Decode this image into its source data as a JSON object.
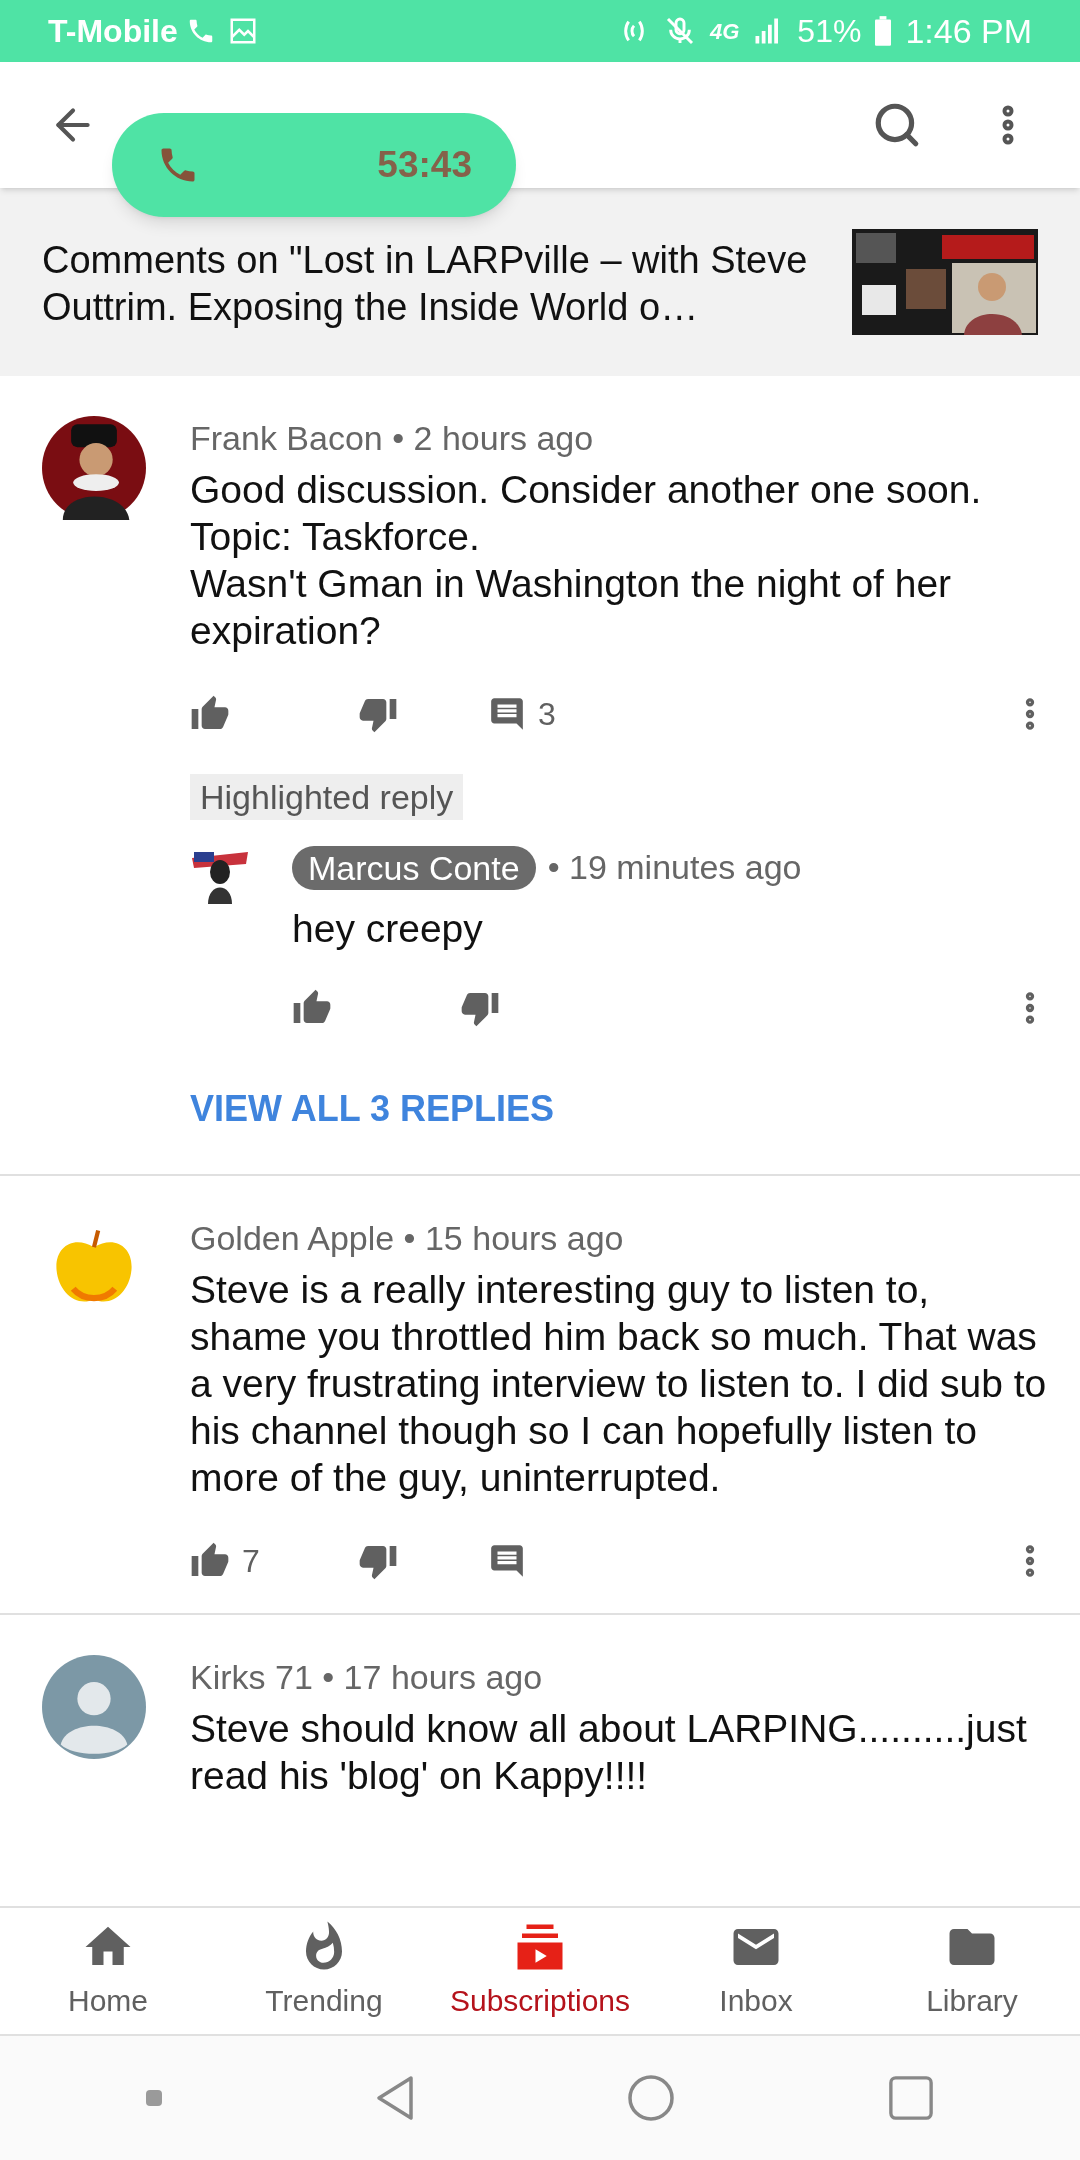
{
  "status_bar": {
    "carrier": "T-Mobile",
    "network": "4G",
    "battery": "51%",
    "time": "1:46 PM"
  },
  "call_pill": {
    "duration": "53:43"
  },
  "video_header": {
    "title": "Comments on \"Lost in LARPville – with Steve Outtrim. Exposing the Inside World o…"
  },
  "comments": [
    {
      "author": "Frank Bacon",
      "time": "• 2 hours ago",
      "avatar": {
        "kind": "portrait"
      },
      "text": "Good discussion. Consider another one soon.\nTopic: Taskforce.\nWasn't Gman in Washington the night of her expiration?",
      "reply_count": "3",
      "highlighted_label": "Highlighted reply",
      "reply": {
        "author": "Marcus Conte",
        "author_chip": true,
        "time": "• 19 minutes ago",
        "text": "hey creepy"
      },
      "view_replies": "VIEW ALL 3 REPLIES"
    },
    {
      "author": "Golden Apple",
      "time": "• 15 hours ago",
      "avatar": {
        "kind": "apple"
      },
      "text": "Steve is a really interesting guy to listen to, shame you throttled him back so much. That was a very frustrating interview to listen to. I did sub to his channel though so I can hopefully listen to more of the guy, uninterrupted.",
      "like_count": "7"
    },
    {
      "author": "Kirks 71",
      "time": "• 17 hours ago",
      "avatar": {
        "kind": "default"
      },
      "text": "Steve should know all about LARPING..........just read his 'blog' on Kappy!!!!"
    }
  ],
  "bottom_nav": [
    {
      "kind": "home",
      "label": "Home",
      "selected": false
    },
    {
      "kind": "trending",
      "label": "Trending",
      "selected": false
    },
    {
      "kind": "subscriptions",
      "label": "Subscriptions",
      "selected": true
    },
    {
      "kind": "inbox",
      "label": "Inbox",
      "selected": false
    },
    {
      "kind": "library",
      "label": "Library",
      "selected": false
    }
  ]
}
